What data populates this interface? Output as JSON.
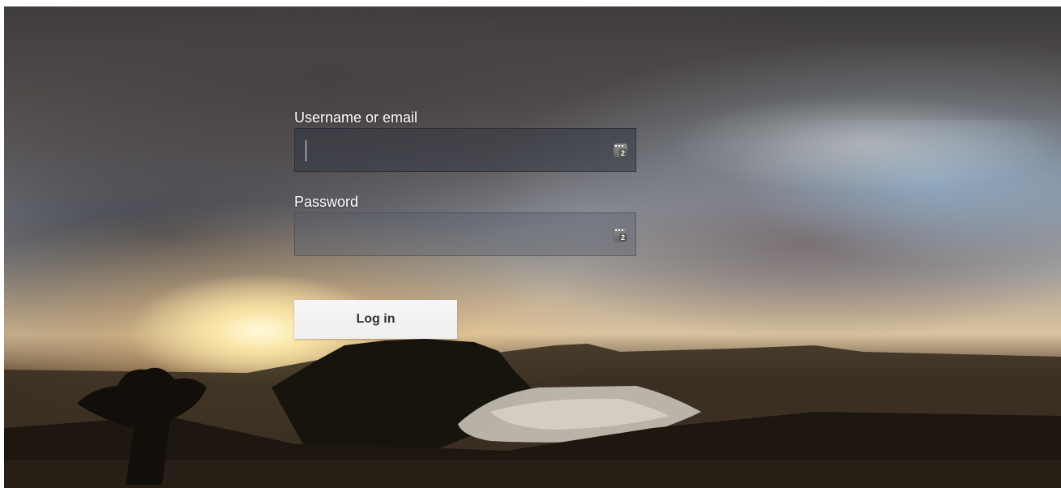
{
  "login": {
    "username_label": "Username or email",
    "username_value": "",
    "password_label": "Password",
    "password_value": "",
    "submit_label": "Log in",
    "password_manager_badge": "2"
  },
  "colors": {
    "label": "#ffffff",
    "button_bg": "#f4f2f2",
    "button_text": "#333333"
  },
  "icons": {
    "password_manager": "password-manager-icon"
  }
}
